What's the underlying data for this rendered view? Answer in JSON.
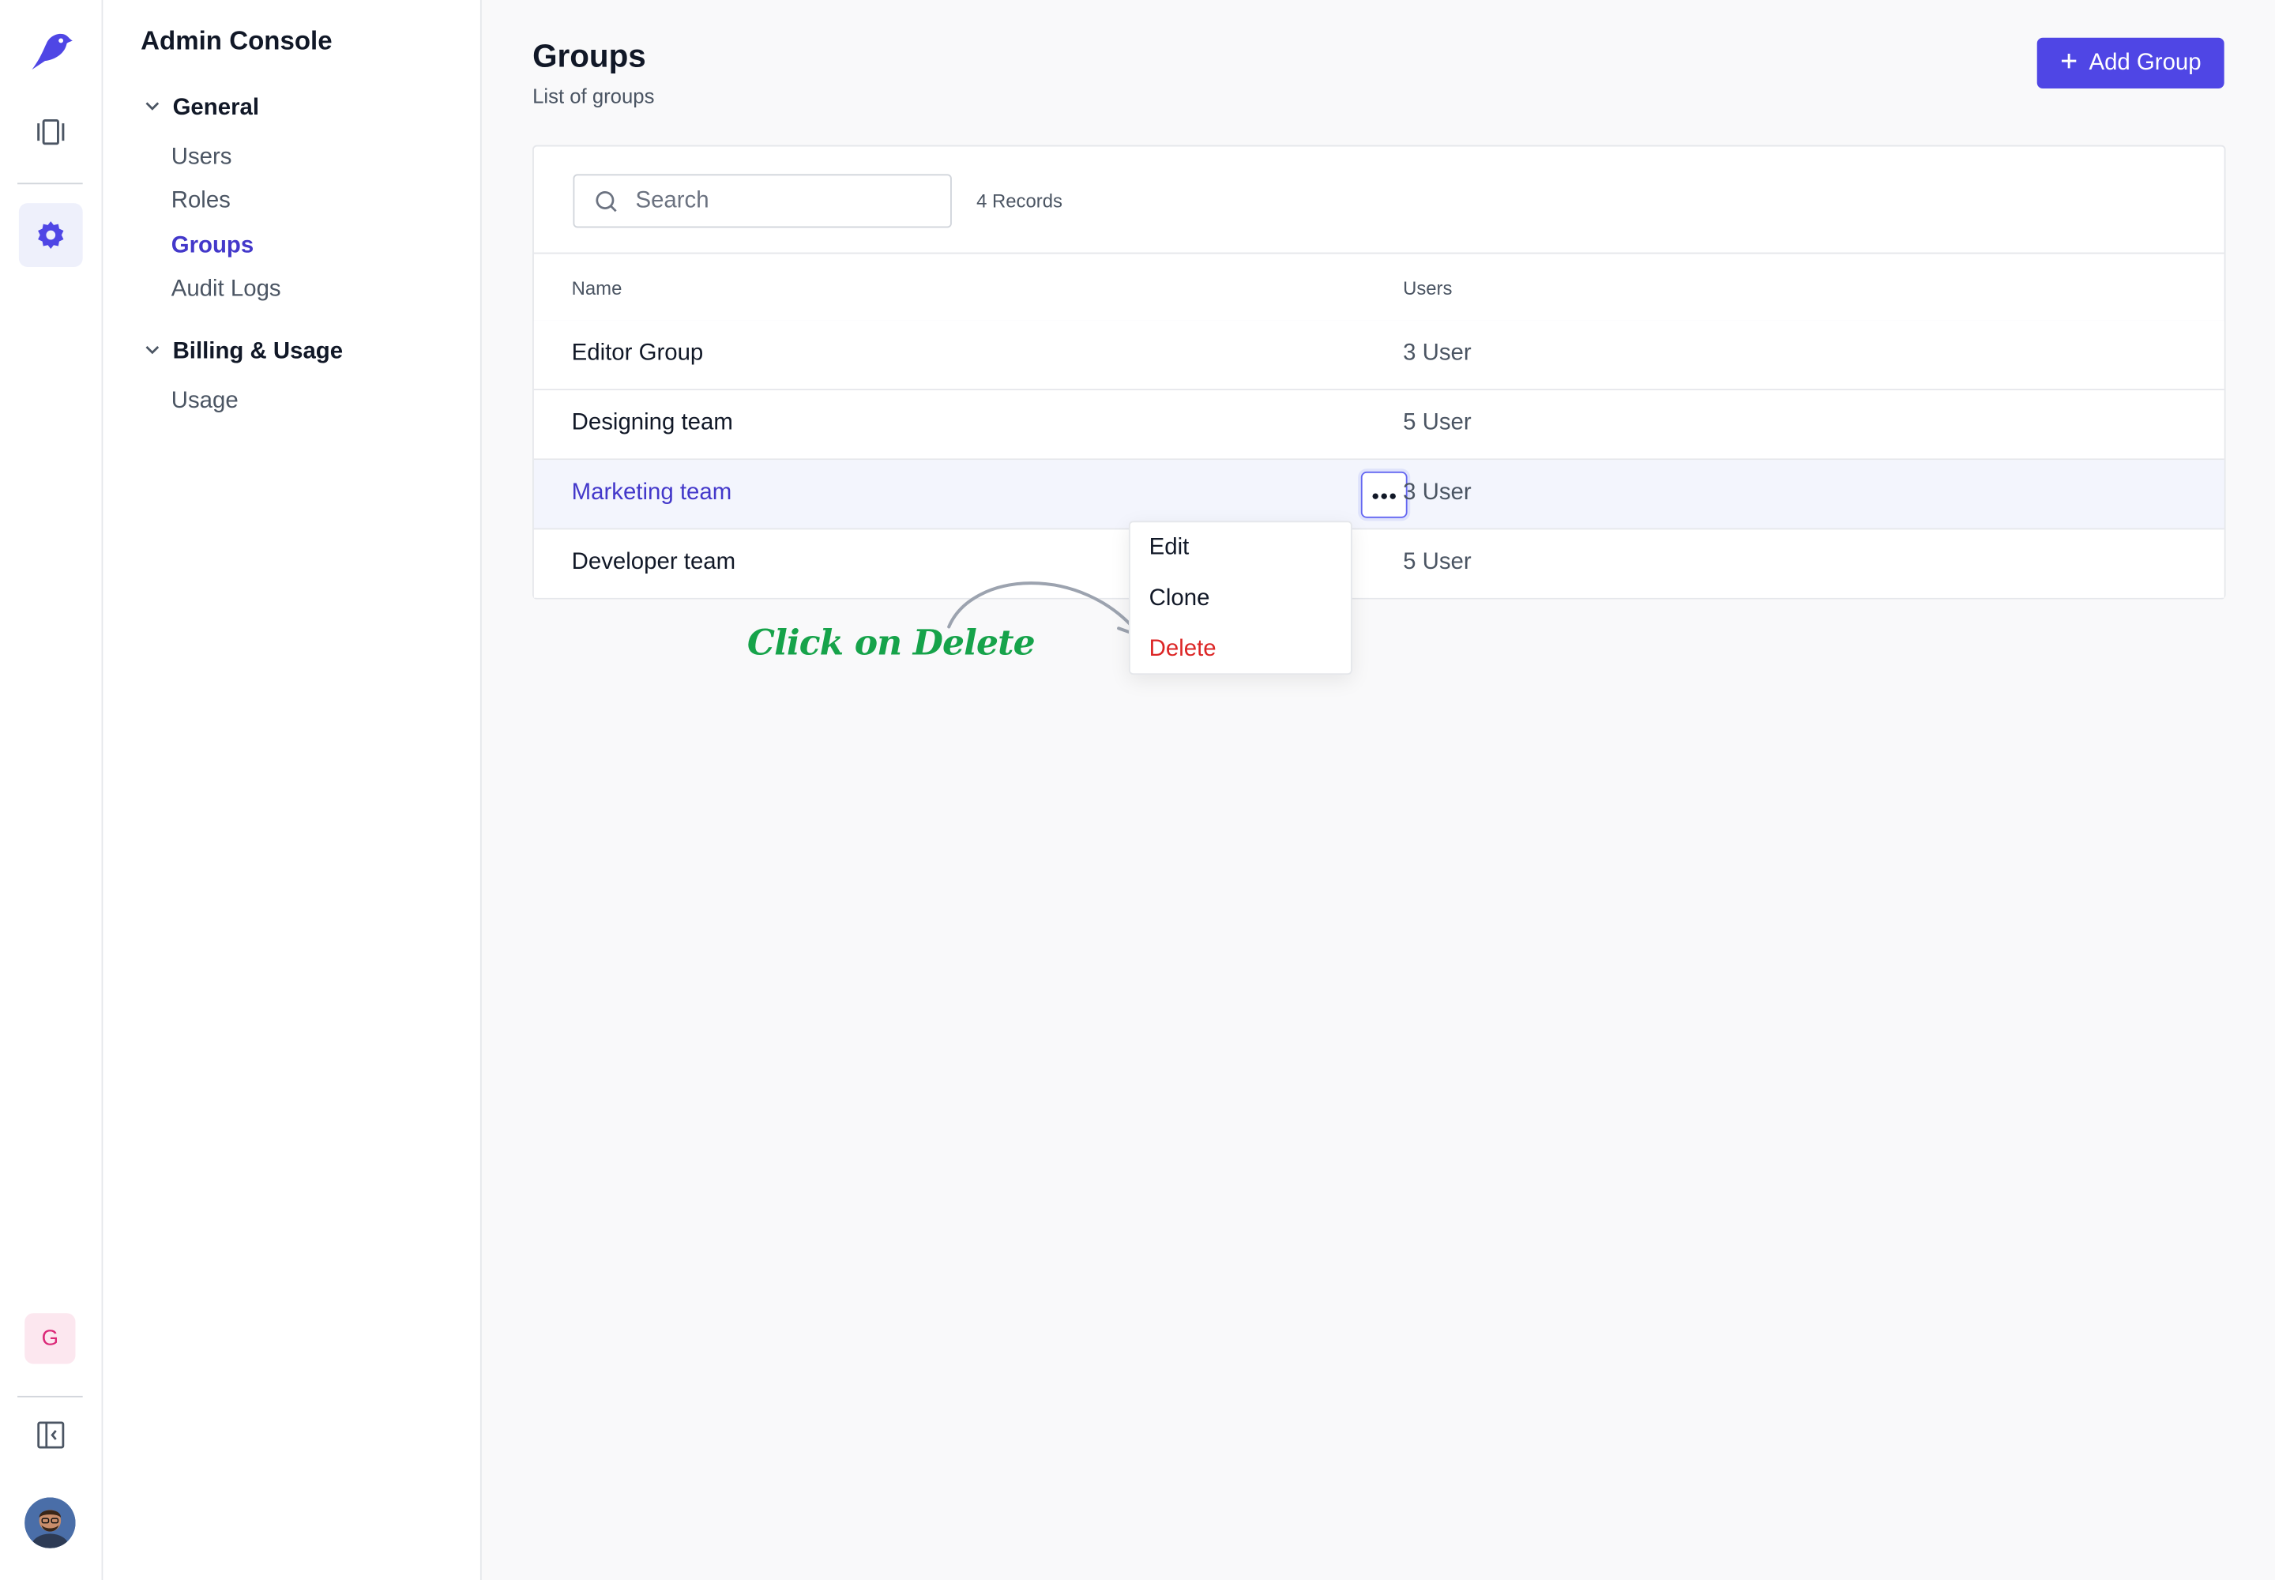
{
  "sidebar": {
    "title": "Admin Console",
    "sections": [
      {
        "label": "General",
        "items": [
          "Users",
          "Roles",
          "Groups",
          "Audit Logs"
        ]
      },
      {
        "label": "Billing & Usage",
        "items": [
          "Usage"
        ]
      }
    ],
    "active_item": "Groups"
  },
  "rail": {
    "icons": [
      "logo-bird-icon",
      "board-icon",
      "settings-icon",
      "collapse-sidebar-icon"
    ],
    "workspace_badge": "G"
  },
  "header": {
    "title": "Groups",
    "subtitle": "List of groups",
    "add_button_label": "Add Group"
  },
  "table": {
    "search_placeholder": "Search",
    "records_label": "4 Records",
    "columns": [
      "Name",
      "Users"
    ],
    "rows": [
      {
        "name": "Editor Group",
        "users": "3 User"
      },
      {
        "name": "Designing team",
        "users": "5 User"
      },
      {
        "name": "Marketing team",
        "users": "3 User"
      },
      {
        "name": "Developer team",
        "users": "5 User"
      }
    ]
  },
  "context_menu": {
    "items": [
      "Edit",
      "Clone",
      "Delete"
    ]
  },
  "annotation": {
    "text": "Click on Delete"
  },
  "colors": {
    "accent": "#4f46e5",
    "danger": "#dc2626",
    "annotation": "#16a34a"
  }
}
